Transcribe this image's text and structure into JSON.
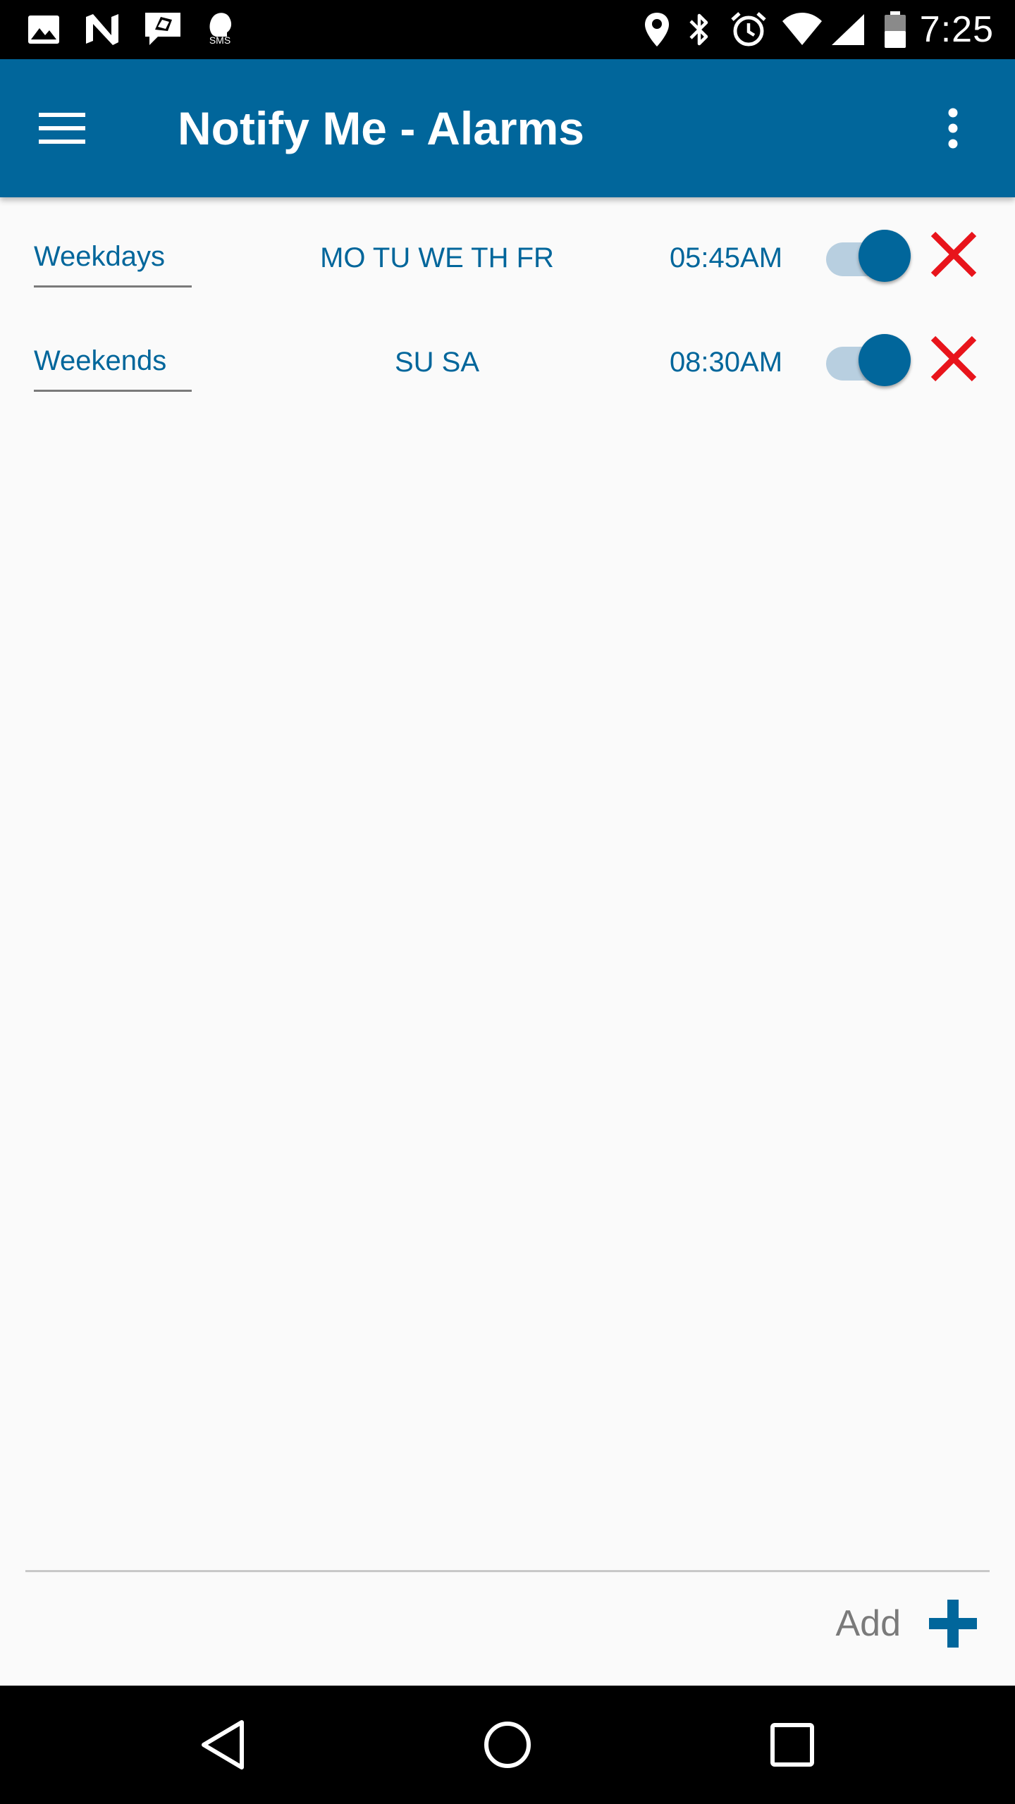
{
  "status_bar": {
    "time": "7:25",
    "notification_icons": [
      "gallery-icon",
      "n-app-icon",
      "message-icon",
      "sms-app-icon"
    ],
    "sms_badge": "SMS",
    "system_icons": [
      "location-icon",
      "bluetooth-icon",
      "alarm-clock-icon",
      "wifi-icon",
      "signal-icon",
      "battery-icon"
    ]
  },
  "app_bar": {
    "title": "Notify Me - Alarms",
    "bg_color": "#01669b"
  },
  "alarms": [
    {
      "name": "Weekdays",
      "days": "MO TU WE TH FR",
      "time": "05:45AM",
      "enabled": true
    },
    {
      "name": "Weekends",
      "days": "SU SA",
      "time": "08:30AM",
      "enabled": true
    }
  ],
  "footer": {
    "add_label": "Add"
  },
  "colors": {
    "accent": "#01669b",
    "delete": "#e8141b",
    "toggle_track": "#b8cfe0"
  },
  "nav_bar": {
    "buttons": [
      "back-icon",
      "home-icon",
      "recents-icon"
    ]
  }
}
